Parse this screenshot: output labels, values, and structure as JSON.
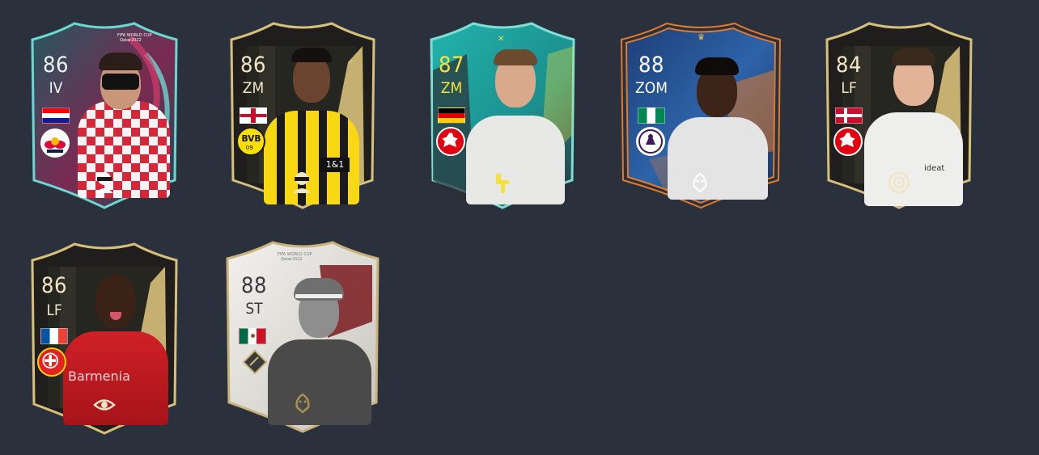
{
  "cards": [
    {
      "rating": "86",
      "position": "IV",
      "theme": {
        "accent": "#6ad8d0",
        "bg1": "#1f4a52",
        "bg2": "#b8244f",
        "text": "#e8f4f4"
      },
      "nation_flag": "croatia",
      "club_badge": "rb-leipzig-badge",
      "trait_icon": "masked-figure-icon",
      "top_text": "FIFA WORLD CUP Qatar2022",
      "shirt": "croatia-checkered"
    },
    {
      "rating": "86",
      "position": "ZM",
      "theme": {
        "accent": "#d7c07a",
        "bg1": "#1d1c1a",
        "bg2": "#353328",
        "text": "#f0e6c6"
      },
      "nation_flag": "england",
      "club_badge": "bvb-badge",
      "trait_icon": "masked-figure-icon",
      "shirt": "bvb-yellow"
    },
    {
      "rating": "87",
      "position": "ZM",
      "theme": {
        "accent": "#7fded3",
        "bg1": "#1e9c9a",
        "bg2": "#2b2f34",
        "text": "#f5e23a"
      },
      "nation_flag": "germany",
      "club_badge": "eintracht-frankfurt-badge",
      "trait_icon": "hammer-icon",
      "shirt": "white"
    },
    {
      "rating": "88",
      "position": "ZOM",
      "theme": {
        "accent": "#e27a2a",
        "bg1": "#1b3c70",
        "bg2": "#2b5fa6",
        "text": "#ffffff"
      },
      "nation_flag": "nigeria",
      "club_badge": "premier-league-badge",
      "trait_icon": "cobra-icon",
      "shirt": "white"
    },
    {
      "rating": "84",
      "position": "LF",
      "theme": {
        "accent": "#d7c07a",
        "bg1": "#1d1c1a",
        "bg2": "#353328",
        "text": "#f0e6c6"
      },
      "nation_flag": "denmark",
      "club_badge": "eintracht-frankfurt-badge",
      "trait_icon": "target-icon",
      "shirt": "white"
    },
    {
      "rating": "86",
      "position": "LF",
      "theme": {
        "accent": "#d7c07a",
        "bg1": "#1d1c1a",
        "bg2": "#353328",
        "text": "#f0e6c6"
      },
      "nation_flag": "france",
      "club_badge": "bayer-leverkusen-badge",
      "trait_icon": "eye-icon",
      "shirt": "leverkusen-red"
    },
    {
      "rating": "88",
      "position": "ST",
      "theme": {
        "accent": "#c9b37a",
        "bg1": "#e6e4df",
        "bg2": "#7a1a1e",
        "text": "#3a3a3a"
      },
      "nation_flag": "mexico",
      "club_badge": "icon-diamond-badge",
      "trait_icon": "cobra-icon",
      "top_text": "FIFA WORLD CUP Qatar2022",
      "shirt": "grey"
    }
  ]
}
